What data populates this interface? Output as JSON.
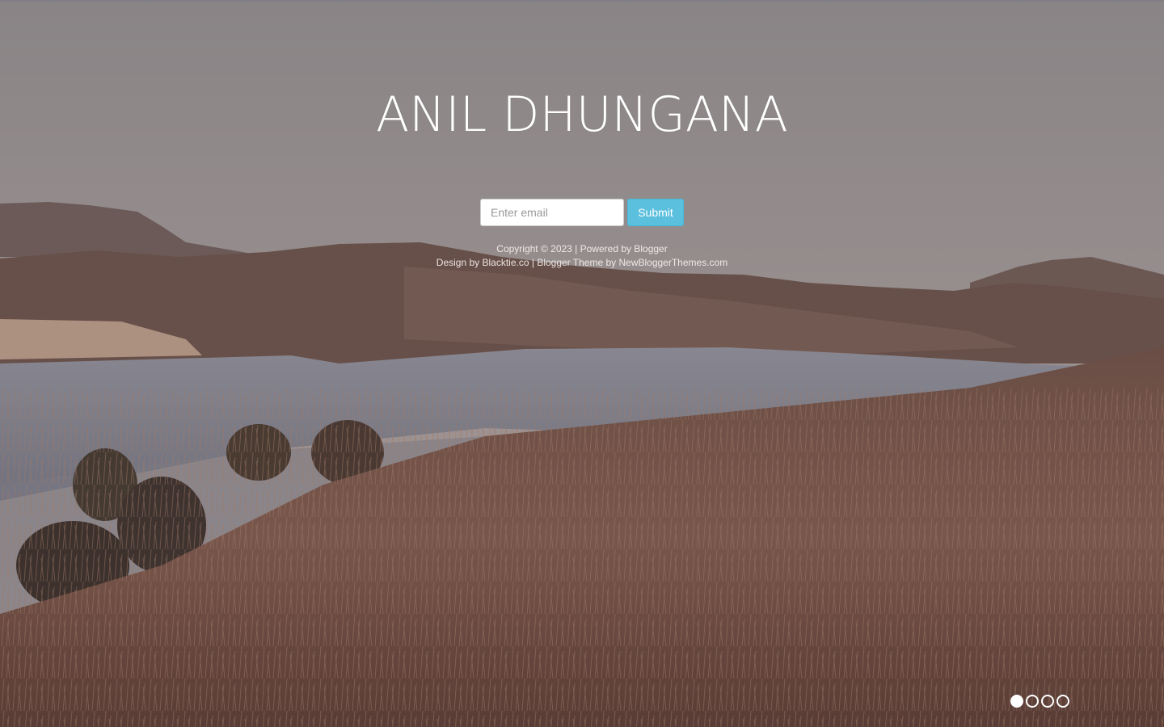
{
  "site": {
    "title": "ANIL DHUNGANA"
  },
  "subscribe": {
    "email_placeholder": "Enter email",
    "submit_label": "Submit"
  },
  "footer": {
    "copyright": "Copyright © 2023 | Powered by ",
    "powered_by_link": "Blogger",
    "design_prefix": "Design by ",
    "design_link": "Blacktie.co",
    "theme_middle": " | Blogger Theme by ",
    "theme_link": "NewBloggerThemes.com"
  },
  "slider": {
    "slide_count": 4,
    "active_slide": 1,
    "dots": [
      {
        "label": "slide-1",
        "active": true
      },
      {
        "label": "slide-2",
        "active": false
      },
      {
        "label": "slide-3",
        "active": false
      },
      {
        "label": "slide-4",
        "active": false
      }
    ]
  },
  "colors": {
    "button_bg": "#5bc0de",
    "title_color": "#ffffff"
  }
}
